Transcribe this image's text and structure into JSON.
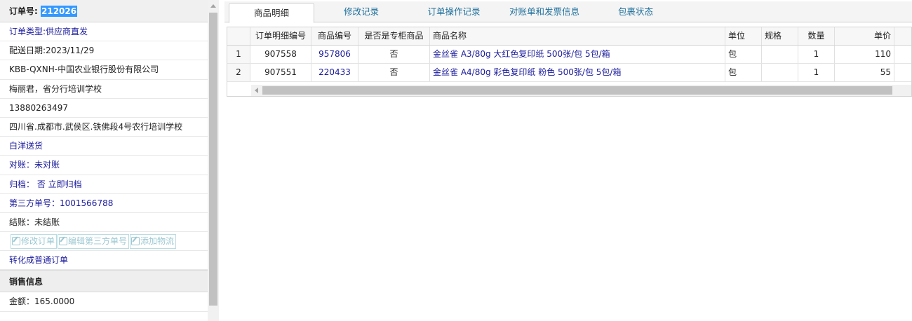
{
  "left": {
    "order_label": "订单号:",
    "order_number": "212026",
    "order_type": "订单类型:供应商直发",
    "delivery_date": "配送日期:2023/11/29",
    "company": "KBB-QXNH-中国农业银行股份有限公司",
    "contact": "梅丽君，省分行培训学校",
    "phone": "13880263497",
    "address": "四川省.成都市.武侯区.铁佛段4号农行培训学校",
    "delivery_method": "白洋送货",
    "reconcile": "对账：未对账",
    "archive": "归档： 否 立即归档",
    "third_party": "第三方单号：1001566788",
    "settlement": "结账：未结账",
    "buttons": [
      "修改订单",
      "编辑第三方单号",
      "添加物流"
    ],
    "convert_link": "转化成普通订单",
    "sales_section": "销售信息",
    "amount": "金额：165.0000"
  },
  "tabs": [
    "商品明细",
    "修改记录",
    "订单操作记录",
    "对账单和发票信息",
    "包裹状态"
  ],
  "grid": {
    "columns": [
      "",
      "订单明细编号",
      "商品编号",
      "是否是专柜商品",
      "商品名称",
      "单位",
      "规格",
      "数量",
      "单价"
    ],
    "rows": [
      {
        "idx": "1",
        "detail_id": "907558",
        "product_id": "957806",
        "is_counter": "否",
        "name": "金丝雀 A3/80g 大红色复印纸 500张/包 5包/箱",
        "unit": "包",
        "spec": "",
        "qty": "1",
        "price": "110"
      },
      {
        "idx": "2",
        "detail_id": "907551",
        "product_id": "220433",
        "is_counter": "否",
        "name": "金丝雀 A4/80g 彩色复印纸 粉色 500张/包 5包/箱",
        "unit": "包",
        "spec": "",
        "qty": "1",
        "price": "55"
      }
    ]
  },
  "colors": {
    "link": "#1a1a9c",
    "tab_text": "#1e6f9c",
    "highlight": "#3399ff"
  }
}
